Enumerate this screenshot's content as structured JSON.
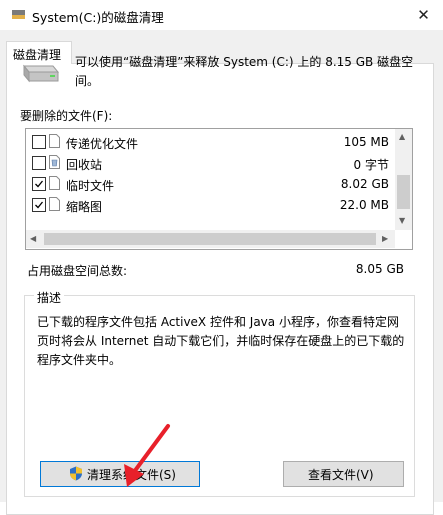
{
  "window": {
    "title": "System(C:)的磁盘清理",
    "close_glyph": "✕"
  },
  "tab": {
    "label": "磁盘清理"
  },
  "intro_text": "可以使用“磁盘清理”来释放 System (C:) 上的 8.15 GB 磁盘空间。",
  "files_label": "要删除的文件(F):",
  "files": [
    {
      "name": "传递优化文件",
      "size": "105 MB",
      "checked": false
    },
    {
      "name": "回收站",
      "size": "0 字节",
      "checked": false
    },
    {
      "name": "临时文件",
      "size": "8.02 GB",
      "checked": true
    },
    {
      "name": "缩略图",
      "size": "22.0 MB",
      "checked": true
    }
  ],
  "total": {
    "label": "占用磁盘空间总数:",
    "value": "8.05 GB"
  },
  "description": {
    "legend": "描述",
    "text": "已下载的程序文件包括 ActiveX 控件和 Java 小程序，你查看特定网页时将会从 Internet 自动下载它们，并临时保存在硬盘上的已下载的程序文件夹中。"
  },
  "buttons": {
    "cleanup_system": "清理系统文件(S)",
    "view_files": "查看文件(V)"
  },
  "colors": {
    "accent": "#0078d7",
    "annotation_arrow": "#e8202a",
    "window_bg": "#f0f0f0"
  },
  "icons": {
    "title": "disk-cleanup-icon",
    "drive": "drive-icon",
    "shield": "uac-shield-icon"
  }
}
